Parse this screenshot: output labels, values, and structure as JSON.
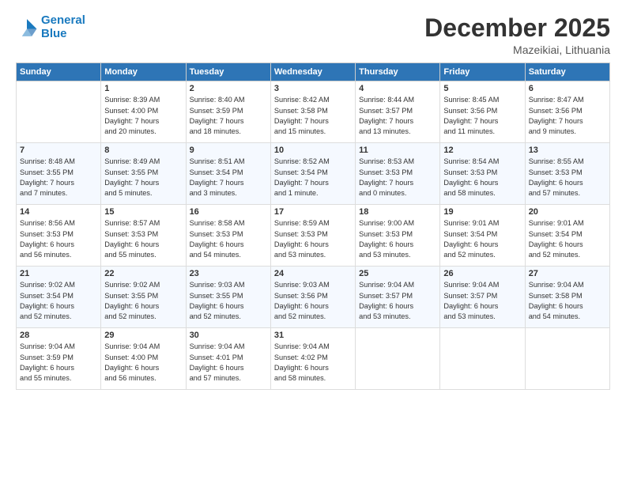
{
  "logo": {
    "line1": "General",
    "line2": "Blue"
  },
  "title": "December 2025",
  "location": "Mazeikiai, Lithuania",
  "days_header": [
    "Sunday",
    "Monday",
    "Tuesday",
    "Wednesday",
    "Thursday",
    "Friday",
    "Saturday"
  ],
  "weeks": [
    [
      {
        "day": "",
        "content": ""
      },
      {
        "day": "1",
        "content": "Sunrise: 8:39 AM\nSunset: 4:00 PM\nDaylight: 7 hours\nand 20 minutes."
      },
      {
        "day": "2",
        "content": "Sunrise: 8:40 AM\nSunset: 3:59 PM\nDaylight: 7 hours\nand 18 minutes."
      },
      {
        "day": "3",
        "content": "Sunrise: 8:42 AM\nSunset: 3:58 PM\nDaylight: 7 hours\nand 15 minutes."
      },
      {
        "day": "4",
        "content": "Sunrise: 8:44 AM\nSunset: 3:57 PM\nDaylight: 7 hours\nand 13 minutes."
      },
      {
        "day": "5",
        "content": "Sunrise: 8:45 AM\nSunset: 3:56 PM\nDaylight: 7 hours\nand 11 minutes."
      },
      {
        "day": "6",
        "content": "Sunrise: 8:47 AM\nSunset: 3:56 PM\nDaylight: 7 hours\nand 9 minutes."
      }
    ],
    [
      {
        "day": "7",
        "content": "Sunrise: 8:48 AM\nSunset: 3:55 PM\nDaylight: 7 hours\nand 7 minutes."
      },
      {
        "day": "8",
        "content": "Sunrise: 8:49 AM\nSunset: 3:55 PM\nDaylight: 7 hours\nand 5 minutes."
      },
      {
        "day": "9",
        "content": "Sunrise: 8:51 AM\nSunset: 3:54 PM\nDaylight: 7 hours\nand 3 minutes."
      },
      {
        "day": "10",
        "content": "Sunrise: 8:52 AM\nSunset: 3:54 PM\nDaylight: 7 hours\nand 1 minute."
      },
      {
        "day": "11",
        "content": "Sunrise: 8:53 AM\nSunset: 3:53 PM\nDaylight: 7 hours\nand 0 minutes."
      },
      {
        "day": "12",
        "content": "Sunrise: 8:54 AM\nSunset: 3:53 PM\nDaylight: 6 hours\nand 58 minutes."
      },
      {
        "day": "13",
        "content": "Sunrise: 8:55 AM\nSunset: 3:53 PM\nDaylight: 6 hours\nand 57 minutes."
      }
    ],
    [
      {
        "day": "14",
        "content": "Sunrise: 8:56 AM\nSunset: 3:53 PM\nDaylight: 6 hours\nand 56 minutes."
      },
      {
        "day": "15",
        "content": "Sunrise: 8:57 AM\nSunset: 3:53 PM\nDaylight: 6 hours\nand 55 minutes."
      },
      {
        "day": "16",
        "content": "Sunrise: 8:58 AM\nSunset: 3:53 PM\nDaylight: 6 hours\nand 54 minutes."
      },
      {
        "day": "17",
        "content": "Sunrise: 8:59 AM\nSunset: 3:53 PM\nDaylight: 6 hours\nand 53 minutes."
      },
      {
        "day": "18",
        "content": "Sunrise: 9:00 AM\nSunset: 3:53 PM\nDaylight: 6 hours\nand 53 minutes."
      },
      {
        "day": "19",
        "content": "Sunrise: 9:01 AM\nSunset: 3:54 PM\nDaylight: 6 hours\nand 52 minutes."
      },
      {
        "day": "20",
        "content": "Sunrise: 9:01 AM\nSunset: 3:54 PM\nDaylight: 6 hours\nand 52 minutes."
      }
    ],
    [
      {
        "day": "21",
        "content": "Sunrise: 9:02 AM\nSunset: 3:54 PM\nDaylight: 6 hours\nand 52 minutes."
      },
      {
        "day": "22",
        "content": "Sunrise: 9:02 AM\nSunset: 3:55 PM\nDaylight: 6 hours\nand 52 minutes."
      },
      {
        "day": "23",
        "content": "Sunrise: 9:03 AM\nSunset: 3:55 PM\nDaylight: 6 hours\nand 52 minutes."
      },
      {
        "day": "24",
        "content": "Sunrise: 9:03 AM\nSunset: 3:56 PM\nDaylight: 6 hours\nand 52 minutes."
      },
      {
        "day": "25",
        "content": "Sunrise: 9:04 AM\nSunset: 3:57 PM\nDaylight: 6 hours\nand 53 minutes."
      },
      {
        "day": "26",
        "content": "Sunrise: 9:04 AM\nSunset: 3:57 PM\nDaylight: 6 hours\nand 53 minutes."
      },
      {
        "day": "27",
        "content": "Sunrise: 9:04 AM\nSunset: 3:58 PM\nDaylight: 6 hours\nand 54 minutes."
      }
    ],
    [
      {
        "day": "28",
        "content": "Sunrise: 9:04 AM\nSunset: 3:59 PM\nDaylight: 6 hours\nand 55 minutes."
      },
      {
        "day": "29",
        "content": "Sunrise: 9:04 AM\nSunset: 4:00 PM\nDaylight: 6 hours\nand 56 minutes."
      },
      {
        "day": "30",
        "content": "Sunrise: 9:04 AM\nSunset: 4:01 PM\nDaylight: 6 hours\nand 57 minutes."
      },
      {
        "day": "31",
        "content": "Sunrise: 9:04 AM\nSunset: 4:02 PM\nDaylight: 6 hours\nand 58 minutes."
      },
      {
        "day": "",
        "content": ""
      },
      {
        "day": "",
        "content": ""
      },
      {
        "day": "",
        "content": ""
      }
    ]
  ]
}
